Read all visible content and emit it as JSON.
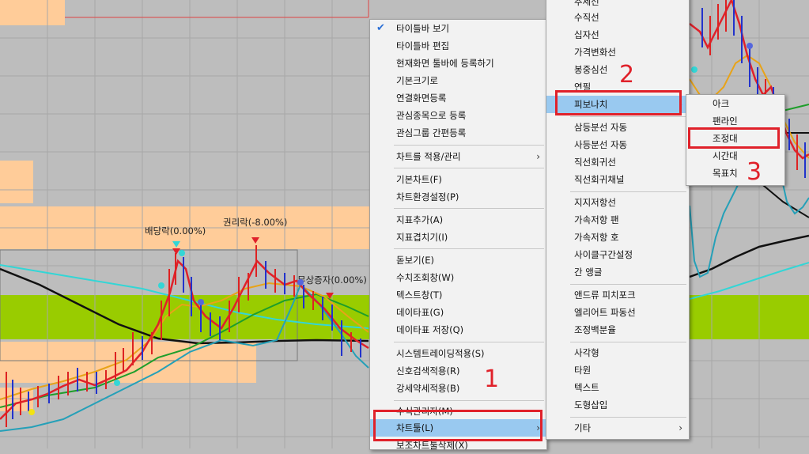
{
  "chart": {
    "annotations": [
      "배당락(0.00%)",
      "권리락(-8.00%)",
      "무상증자(0.00%)"
    ]
  },
  "context_menu": {
    "items": [
      {
        "label": "타이틀바 보기",
        "checked": true
      },
      {
        "label": "타이틀바 편집"
      },
      {
        "label": "현재화면 툴바에 등록하기"
      },
      {
        "label": "기본크기로"
      },
      {
        "label": "연결화면등록"
      },
      {
        "label": "관심종목으로 등록"
      },
      {
        "label": "관심그룹 간편등록"
      },
      {
        "label": "차트를 적용/관리",
        "submenu": true
      },
      {
        "label": "기본차트(F)"
      },
      {
        "label": "차트환경설정(P)"
      },
      {
        "label": "지표추가(A)"
      },
      {
        "label": "지표겹치기(I)"
      },
      {
        "label": "돋보기(E)"
      },
      {
        "label": "수치조회창(W)"
      },
      {
        "label": "텍스트창(T)"
      },
      {
        "label": "데이타표(G)"
      },
      {
        "label": "데이타표 저장(Q)"
      },
      {
        "label": "시스템트레이딩적용(S)"
      },
      {
        "label": "신호검색적용(R)"
      },
      {
        "label": "강세약세적용(B)"
      },
      {
        "label": "수식관리자(M)"
      },
      {
        "label": "차트툴(L)",
        "submenu": true,
        "highlighted": true
      },
      {
        "label": "보조차트툴삭제(X)"
      }
    ]
  },
  "tool_menu": {
    "items": [
      {
        "label": "추세선"
      },
      {
        "label": "수직선"
      },
      {
        "label": "십자선"
      },
      {
        "label": "가격변화선"
      },
      {
        "label": "봉중심선"
      },
      {
        "label": "연필"
      },
      {
        "label": "피보나치",
        "submenu": true,
        "highlighted": true
      },
      {
        "label": "삼등분선 자동"
      },
      {
        "label": "사등분선 자동"
      },
      {
        "label": "직선회귀선"
      },
      {
        "label": "직선회귀채널"
      },
      {
        "label": "지지저항선"
      },
      {
        "label": "가속저항 팬"
      },
      {
        "label": "가속저항 호"
      },
      {
        "label": "사이클구간설정"
      },
      {
        "label": "간 앵글"
      },
      {
        "label": "앤드류 피치포크"
      },
      {
        "label": "엘리어트 파동선"
      },
      {
        "label": "조정백분율"
      },
      {
        "label": "사각형"
      },
      {
        "label": "타원"
      },
      {
        "label": "텍스트"
      },
      {
        "label": "도형삽입"
      },
      {
        "label": "기타",
        "submenu": true
      }
    ]
  },
  "fib_menu": {
    "items": [
      {
        "label": "아크"
      },
      {
        "label": "팬라인"
      },
      {
        "label": "조정대",
        "boxed": true
      },
      {
        "label": "시간대"
      },
      {
        "label": "목표치"
      }
    ]
  },
  "markers": {
    "step1": "1",
    "step2": "2",
    "step3": "3"
  },
  "icons": {
    "check": "✔",
    "submenu_arrow": "›"
  },
  "colors": {
    "highlight": "#99c9f0",
    "annotation_red": "#e0212a",
    "band_orange": "#ffcc99",
    "band_green": "#99cc00"
  }
}
